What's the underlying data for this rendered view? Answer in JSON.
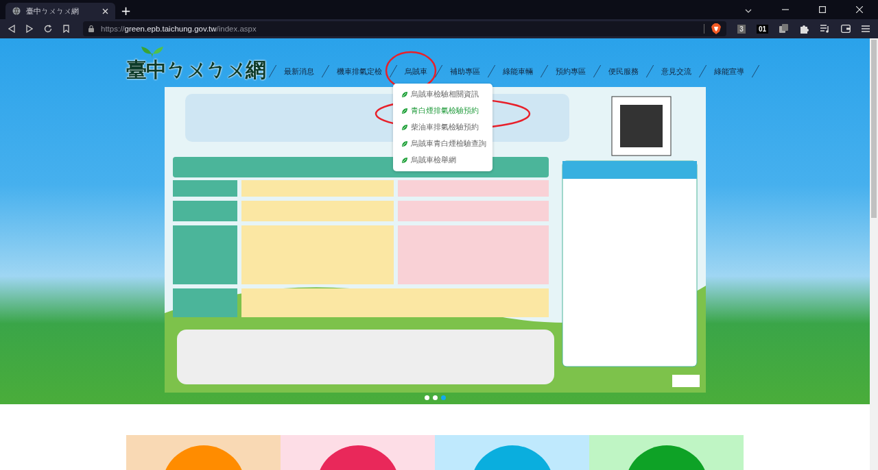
{
  "browser": {
    "tabs": [
      {
        "title": "臺中ㄅㄨㄅㄨ網",
        "selected": true
      }
    ],
    "new_tab": "+",
    "url": {
      "scheme": "https://",
      "host": "green.epb.taichung.gov.tw",
      "path": "/index.aspx"
    },
    "badges": [
      "3",
      "01"
    ]
  },
  "site": {
    "logo": "臺中ㄅㄨㄅㄨ網",
    "nav": [
      {
        "label": "最新消息"
      },
      {
        "label": "機車排氣定檢"
      },
      {
        "label": "烏賊車",
        "dropdown": [
          {
            "label": "烏賊車檢驗相關資訊",
            "selected": false
          },
          {
            "label": "青白煙排氣檢驗預約",
            "selected": true
          },
          {
            "label": "柴油車排氣檢驗預約",
            "selected": false
          },
          {
            "label": "烏賊車青白煙檢驗查詢",
            "selected": false
          },
          {
            "label": "烏賊車檢舉網",
            "selected": false
          }
        ]
      },
      {
        "label": "補助專區"
      },
      {
        "label": "綠能車輛"
      },
      {
        "label": "預約專區"
      },
      {
        "label": "便民服務"
      },
      {
        "label": "意見交流"
      },
      {
        "label": "綠能宣導"
      }
    ],
    "carousel_dots": [
      {
        "selected": false
      },
      {
        "selected": false
      },
      {
        "selected": true
      }
    ],
    "cards": [
      {
        "color": "#f9d9b4",
        "circle": {
          "color": "#ff8c00"
        }
      },
      {
        "color": "#fddde6",
        "circle": {
          "color": "#e9285a"
        }
      },
      {
        "color": "#bfe9fd",
        "circle": {
          "color": "#0aaede"
        }
      },
      {
        "color": "#bff5c4",
        "circle": {
          "color": "#0ea226"
        }
      }
    ]
  },
  "annotations": [
    {
      "kind": "ellipse"
    },
    {
      "kind": "ellipse"
    }
  ]
}
